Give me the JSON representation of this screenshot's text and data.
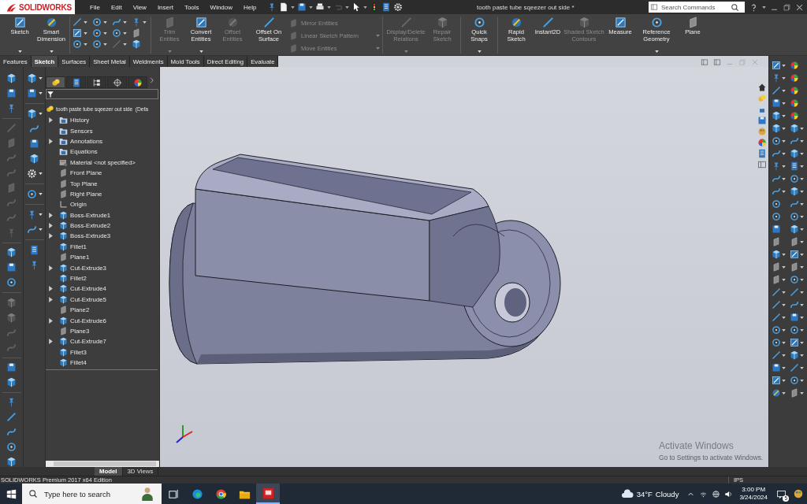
{
  "logo": "SOLIDWORKS",
  "menu": [
    "File",
    "Edit",
    "View",
    "Insert",
    "Tools",
    "Window",
    "Help"
  ],
  "title": "tooth paste tube sqeezer out side *",
  "search": {
    "placeholder": "Search Commands"
  },
  "ribbon": [
    [
      {
        "kind": "large",
        "label": "Sketch",
        "dropdown": true,
        "disabled": false
      },
      {
        "kind": "large",
        "label": "Smart Dimension",
        "dropdown": true,
        "disabled": false
      }
    ],
    [
      {
        "kind": "grid"
      }
    ],
    [
      {
        "kind": "large",
        "label": "Trim Entities",
        "dropdown": true,
        "disabled": true
      },
      {
        "kind": "large",
        "label": "Convert Entities",
        "dropdown": true,
        "disabled": false
      },
      {
        "kind": "large",
        "label": "Offset Entities",
        "dropdown": false,
        "disabled": true
      },
      {
        "kind": "large",
        "label": "Offset On Surface",
        "dropdown": false,
        "disabled": false
      },
      {
        "kind": "stack",
        "items": [
          {
            "label": "Mirror Entities",
            "dropdown": false,
            "disabled": true
          },
          {
            "label": "Linear Sketch Pattern",
            "dropdown": true,
            "disabled": true
          },
          {
            "label": "Move Entities",
            "dropdown": true,
            "disabled": true
          }
        ]
      }
    ],
    [
      {
        "kind": "large",
        "label": "Display/Delete Relations",
        "dropdown": true,
        "disabled": true
      },
      {
        "kind": "large",
        "label": "Repair Sketch",
        "dropdown": false,
        "disabled": true
      }
    ],
    [
      {
        "kind": "large",
        "label": "Quick Snaps",
        "dropdown": true,
        "disabled": false
      }
    ],
    [
      {
        "kind": "large",
        "label": "Rapid Sketch",
        "dropdown": false,
        "disabled": false
      },
      {
        "kind": "large",
        "label": "Instant2D",
        "dropdown": false,
        "disabled": false
      },
      {
        "kind": "large",
        "label": "Shaded Sketch Contours",
        "dropdown": false,
        "disabled": true
      },
      {
        "kind": "large",
        "label": "Measure",
        "dropdown": false,
        "disabled": false
      },
      {
        "kind": "large",
        "label": "Reference Geometry",
        "dropdown": true,
        "disabled": false
      },
      {
        "kind": "large",
        "label": "Plane",
        "dropdown": false,
        "disabled": false
      }
    ]
  ],
  "tabs": [
    {
      "label": "Features",
      "selected": false
    },
    {
      "label": "Sketch",
      "selected": true
    },
    {
      "label": "Surfaces",
      "selected": false
    },
    {
      "label": "Sheet Metal",
      "selected": false
    },
    {
      "label": "Weldments",
      "selected": false
    },
    {
      "label": "Mold Tools",
      "selected": false
    },
    {
      "label": "Direct Editing",
      "selected": false
    },
    {
      "label": "Evaluate",
      "selected": false
    }
  ],
  "panel_tabs": [
    {
      "selected": true
    },
    {
      "selected": false
    },
    {
      "selected": false
    },
    {
      "selected": false
    },
    {
      "selected": false
    }
  ],
  "tree": {
    "root": "tooth paste tube sqeezer out side  (Defa",
    "items": [
      {
        "label": "History",
        "kind": "folder",
        "expandable": true
      },
      {
        "label": "Sensors",
        "kind": "folder",
        "expandable": false
      },
      {
        "label": "Annotations",
        "kind": "folder",
        "expandable": true
      },
      {
        "label": "Equations",
        "kind": "folder",
        "expandable": false
      },
      {
        "label": "Material <not specified>",
        "kind": "material",
        "expandable": false
      },
      {
        "label": "Front Plane",
        "kind": "plane",
        "expandable": false
      },
      {
        "label": "Top Plane",
        "kind": "plane",
        "expandable": false
      },
      {
        "label": "Right Plane",
        "kind": "plane",
        "expandable": false
      },
      {
        "label": "Origin",
        "kind": "origin",
        "expandable": false
      },
      {
        "label": "Boss-Extrude1",
        "kind": "feature",
        "expandable": true
      },
      {
        "label": "Boss-Extrude2",
        "kind": "feature",
        "expandable": true
      },
      {
        "label": "Boss-Extrude3",
        "kind": "feature",
        "expandable": true
      },
      {
        "label": "Fillet1",
        "kind": "feature",
        "expandable": false
      },
      {
        "label": "Plane1",
        "kind": "plane",
        "expandable": false
      },
      {
        "label": "Cut-Extrude3",
        "kind": "feature",
        "expandable": true
      },
      {
        "label": "Fillet2",
        "kind": "feature",
        "expandable": false
      },
      {
        "label": "Cut-Extrude4",
        "kind": "feature",
        "expandable": true
      },
      {
        "label": "Cut-Extrude5",
        "kind": "feature",
        "expandable": true
      },
      {
        "label": "Plane2",
        "kind": "plane",
        "expandable": false
      },
      {
        "label": "Cut-Extrude6",
        "kind": "feature",
        "expandable": true
      },
      {
        "label": "Plane3",
        "kind": "plane",
        "expandable": false
      },
      {
        "label": "Cut-Extrude7",
        "kind": "feature",
        "expandable": true
      },
      {
        "label": "Fillet3",
        "kind": "feature",
        "expandable": false
      },
      {
        "label": "Fillet4",
        "kind": "feature",
        "expandable": false
      }
    ]
  },
  "activation_notice": {
    "title": "Activate Windows",
    "text": "Go to Settings to activate Windows."
  },
  "bottom_tabs": [
    {
      "label": "Model",
      "selected": true
    },
    {
      "label": "3D Views",
      "selected": false
    }
  ],
  "status": {
    "text": "SOLIDWORKS Premium 2017 x64 Edition",
    "units": "IPS"
  },
  "taskbar": {
    "search_placeholder": "Type here to search",
    "temperature": "34°F",
    "condition": "Cloudy",
    "time": "3:00 PM",
    "date": "3/24/2024",
    "notifications": "5"
  }
}
